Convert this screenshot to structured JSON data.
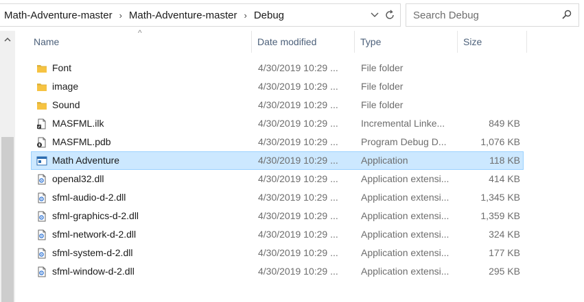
{
  "address": {
    "crumbs": [
      "Math-Adventure-master",
      "Math-Adventure-master",
      "Debug"
    ],
    "separator": "›",
    "dropdown_icon": "chevron-down-icon",
    "refresh_icon": "refresh-icon"
  },
  "search": {
    "placeholder": "Search Debug",
    "icon": "search-icon"
  },
  "columns": {
    "name": "Name",
    "date": "Date modified",
    "type": "Type",
    "size": "Size"
  },
  "colors": {
    "selection_bg": "#cce8ff",
    "selection_border": "#99d1ff",
    "header_text": "#4c607a",
    "folder": "#f6c342"
  },
  "files": [
    {
      "name": "Font",
      "date": "4/30/2019 10:29 ...",
      "type": "File folder",
      "size": "",
      "icon": "folder-icon",
      "selected": false
    },
    {
      "name": "image",
      "date": "4/30/2019 10:29 ...",
      "type": "File folder",
      "size": "",
      "icon": "folder-icon",
      "selected": false
    },
    {
      "name": "Sound",
      "date": "4/30/2019 10:29 ...",
      "type": "File folder",
      "size": "",
      "icon": "folder-icon",
      "selected": false
    },
    {
      "name": "MASFML.ilk",
      "date": "4/30/2019 10:29 ...",
      "type": "Incremental Linke...",
      "size": "849 KB",
      "icon": "ilk-file-icon",
      "selected": false
    },
    {
      "name": "MASFML.pdb",
      "date": "4/30/2019 10:29 ...",
      "type": "Program Debug D...",
      "size": "1,076 KB",
      "icon": "pdb-file-icon",
      "selected": false
    },
    {
      "name": "Math Adventure",
      "date": "4/30/2019 10:29 ...",
      "type": "Application",
      "size": "118 KB",
      "icon": "application-icon",
      "selected": true
    },
    {
      "name": "openal32.dll",
      "date": "4/30/2019 10:29 ...",
      "type": "Application extensi...",
      "size": "414 KB",
      "icon": "dll-file-icon",
      "selected": false
    },
    {
      "name": "sfml-audio-d-2.dll",
      "date": "4/30/2019 10:29 ...",
      "type": "Application extensi...",
      "size": "1,345 KB",
      "icon": "dll-file-icon",
      "selected": false
    },
    {
      "name": "sfml-graphics-d-2.dll",
      "date": "4/30/2019 10:29 ...",
      "type": "Application extensi...",
      "size": "1,359 KB",
      "icon": "dll-file-icon",
      "selected": false
    },
    {
      "name": "sfml-network-d-2.dll",
      "date": "4/30/2019 10:29 ...",
      "type": "Application extensi...",
      "size": "324 KB",
      "icon": "dll-file-icon",
      "selected": false
    },
    {
      "name": "sfml-system-d-2.dll",
      "date": "4/30/2019 10:29 ...",
      "type": "Application extensi...",
      "size": "177 KB",
      "icon": "dll-file-icon",
      "selected": false
    },
    {
      "name": "sfml-window-d-2.dll",
      "date": "4/30/2019 10:29 ...",
      "type": "Application extensi...",
      "size": "295 KB",
      "icon": "dll-file-icon",
      "selected": false
    }
  ]
}
